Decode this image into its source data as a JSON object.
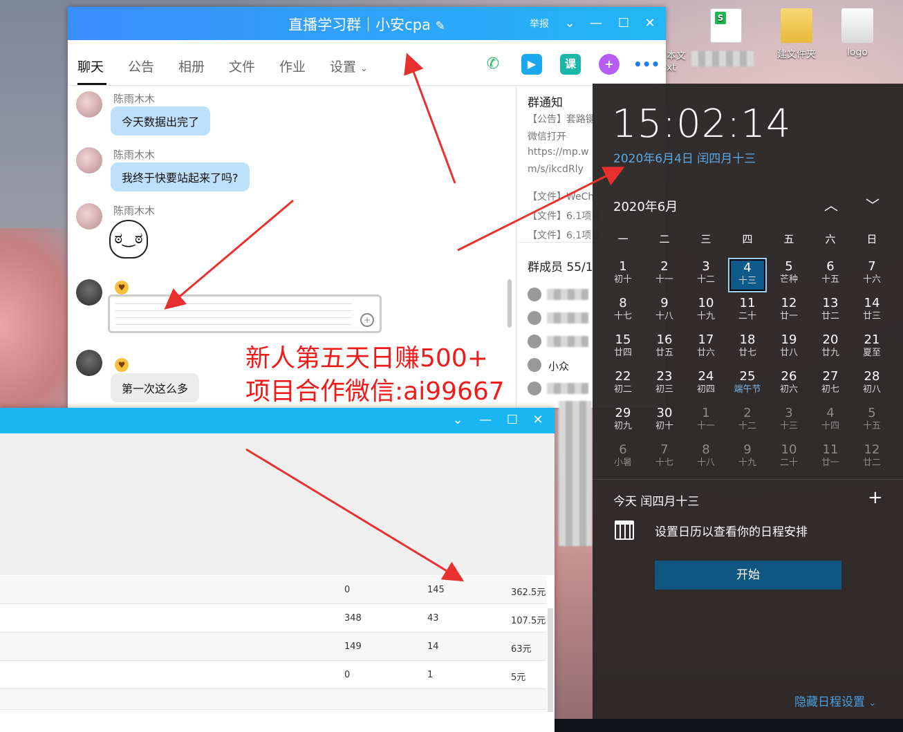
{
  "chat_window": {
    "title": "直播学习群｜小安cpa",
    "report_label": "举报",
    "tabs": [
      "聊天",
      "公告",
      "相册",
      "文件",
      "作业",
      "设置"
    ],
    "messages": [
      {
        "sender": "陈雨木木",
        "text": "今天数据出完了"
      },
      {
        "sender": "陈雨木木",
        "text": "我终于快要站起来了吗?"
      },
      {
        "sender": "陈雨木木"
      },
      {
        "sender": ""
      },
      {
        "sender": "",
        "text": "第一次这么多"
      }
    ],
    "side": {
      "notice_header": "群通知",
      "notice_lines": [
        "【公告】套路键",
        "微信打开",
        "https://mp.w",
        "m/s/ikcdRly",
        "【文件】WeCh",
        "【文件】6.1项目",
        "【文件】6.1项目"
      ],
      "members_header": "群成员 55/1",
      "member_name": "小众"
    }
  },
  "promo": {
    "line1": "新人第五天日赚500+",
    "line2": "项目合作微信:ai99667"
  },
  "data_window": {
    "rows": [
      [
        "0",
        "145",
        "362.5元"
      ],
      [
        "348",
        "43",
        "107.5元"
      ],
      [
        "149",
        "14",
        "63元"
      ],
      [
        "0",
        "1",
        "5元"
      ]
    ]
  },
  "calendar": {
    "time": "15:02:14",
    "date_line": "2020年6月4日 闰四月十三",
    "month_label": "2020年6月",
    "weekdays": [
      "一",
      "二",
      "三",
      "四",
      "五",
      "六",
      "日"
    ],
    "days": [
      [
        "1",
        "初十"
      ],
      [
        "2",
        "十一"
      ],
      [
        "3",
        "十二"
      ],
      [
        "4",
        "十三"
      ],
      [
        "5",
        "芒种"
      ],
      [
        "6",
        "十五"
      ],
      [
        "7",
        "十六"
      ],
      [
        "8",
        "十七"
      ],
      [
        "9",
        "十八"
      ],
      [
        "10",
        "十九"
      ],
      [
        "11",
        "二十"
      ],
      [
        "12",
        "廿一"
      ],
      [
        "13",
        "廿二"
      ],
      [
        "14",
        "廿三"
      ],
      [
        "15",
        "廿四"
      ],
      [
        "16",
        "廿五"
      ],
      [
        "17",
        "廿六"
      ],
      [
        "18",
        "廿七"
      ],
      [
        "19",
        "廿八"
      ],
      [
        "20",
        "廿九"
      ],
      [
        "21",
        "夏至"
      ],
      [
        "22",
        "初二"
      ],
      [
        "23",
        "初三"
      ],
      [
        "24",
        "初四"
      ],
      [
        "25",
        "端午节"
      ],
      [
        "26",
        "初六"
      ],
      [
        "27",
        "初七"
      ],
      [
        "28",
        "初八"
      ],
      [
        "29",
        "初九"
      ],
      [
        "30",
        "初十"
      ],
      [
        "1",
        "十一"
      ],
      [
        "2",
        "十二"
      ],
      [
        "3",
        "十三"
      ],
      [
        "4",
        "十四"
      ],
      [
        "5",
        "十五"
      ],
      [
        "6",
        "小暑"
      ],
      [
        "7",
        "十七"
      ],
      [
        "8",
        "十八"
      ],
      [
        "9",
        "十九"
      ],
      [
        "10",
        "二十"
      ],
      [
        "11",
        "廿一"
      ],
      [
        "12",
        "廿二"
      ]
    ],
    "today_label": "今天 闰四月十三",
    "agenda_message": "设置日历以查看你的日程安排",
    "start_button": "开始",
    "hide_link": "隐藏日程设置"
  },
  "desktop": {
    "icons": [
      "本文\nxt",
      "建文件夹",
      "logo"
    ]
  },
  "colors": {
    "chat_title_start": "#3b8dfd",
    "chat_title_end": "#22b7f6",
    "promo_red": "#f01a1a",
    "calendar_bg": "#2b2627",
    "calendar_today": "#0e5a8a",
    "link_blue": "#5aa8e6",
    "arrow_red": "#e8312f"
  }
}
